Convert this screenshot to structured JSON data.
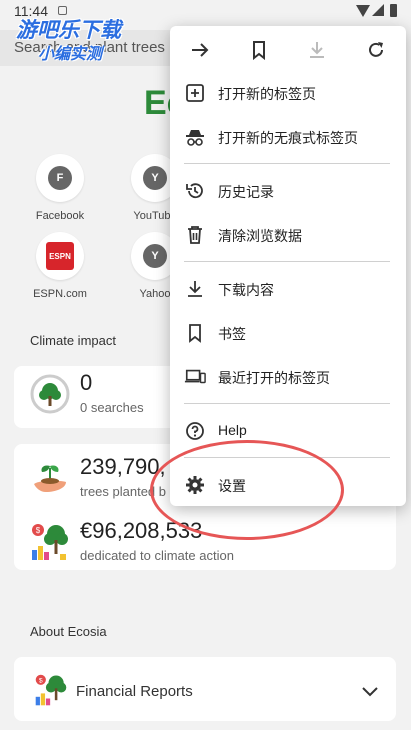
{
  "status_bar": {
    "time": "11:44"
  },
  "search": {
    "placeholder": "Search and plant trees"
  },
  "logo": "Ec",
  "shortcuts": [
    {
      "letter": "F",
      "label": "Facebook",
      "icon": "facebook-icon"
    },
    {
      "letter": "Y",
      "label": "YouTube",
      "icon": "youtube-icon"
    },
    {
      "letter": "ESPN",
      "label": "ESPN.com",
      "icon": "espn-icon"
    },
    {
      "letter": "Y",
      "label": "Yahoo",
      "icon": "yahoo-icon"
    }
  ],
  "climate_impact": {
    "title": "Climate impact",
    "rows": [
      {
        "value": "0",
        "sub": "0 searches",
        "icon": "tree-icon"
      },
      {
        "value": "239,790,",
        "sub": "trees planted b",
        "icon": "hand-plant-icon"
      },
      {
        "value": "€96,208,533",
        "sub": "dedicated to climate action",
        "icon": "finance-tree-icon"
      }
    ]
  },
  "about": {
    "title": "About Ecosia",
    "rows": [
      {
        "label": "Financial Reports",
        "icon": "finance-tree-icon"
      }
    ]
  },
  "menu": {
    "toolbar": [
      {
        "name": "forward-button",
        "icon": "arrow-right-icon"
      },
      {
        "name": "bookmark-button",
        "icon": "bookmark-icon"
      },
      {
        "name": "download-page-button",
        "icon": "download-icon"
      },
      {
        "name": "reload-button",
        "icon": "refresh-icon"
      }
    ],
    "items": [
      {
        "label": "打开新的标签页",
        "icon": "new-tab-icon"
      },
      {
        "label": "打开新的无痕式标签页",
        "icon": "incognito-icon"
      },
      {
        "label": "历史记录",
        "icon": "history-icon"
      },
      {
        "label": "清除浏览数据",
        "icon": "trash-icon"
      },
      {
        "label": "下载内容",
        "icon": "download-icon"
      },
      {
        "label": "书签",
        "icon": "bookmark-icon"
      },
      {
        "label": "最近打开的标签页",
        "icon": "devices-icon"
      },
      {
        "label": "Help",
        "icon": "help-icon"
      },
      {
        "label": "设置",
        "icon": "gear-icon"
      }
    ]
  },
  "watermark": {
    "line1": "游吧乐下载",
    "line2": "小编实测"
  },
  "colors": {
    "accent_green": "#2d8a3a",
    "annotation_red": "#e65656",
    "watermark_blue": "#2b6ee0"
  }
}
